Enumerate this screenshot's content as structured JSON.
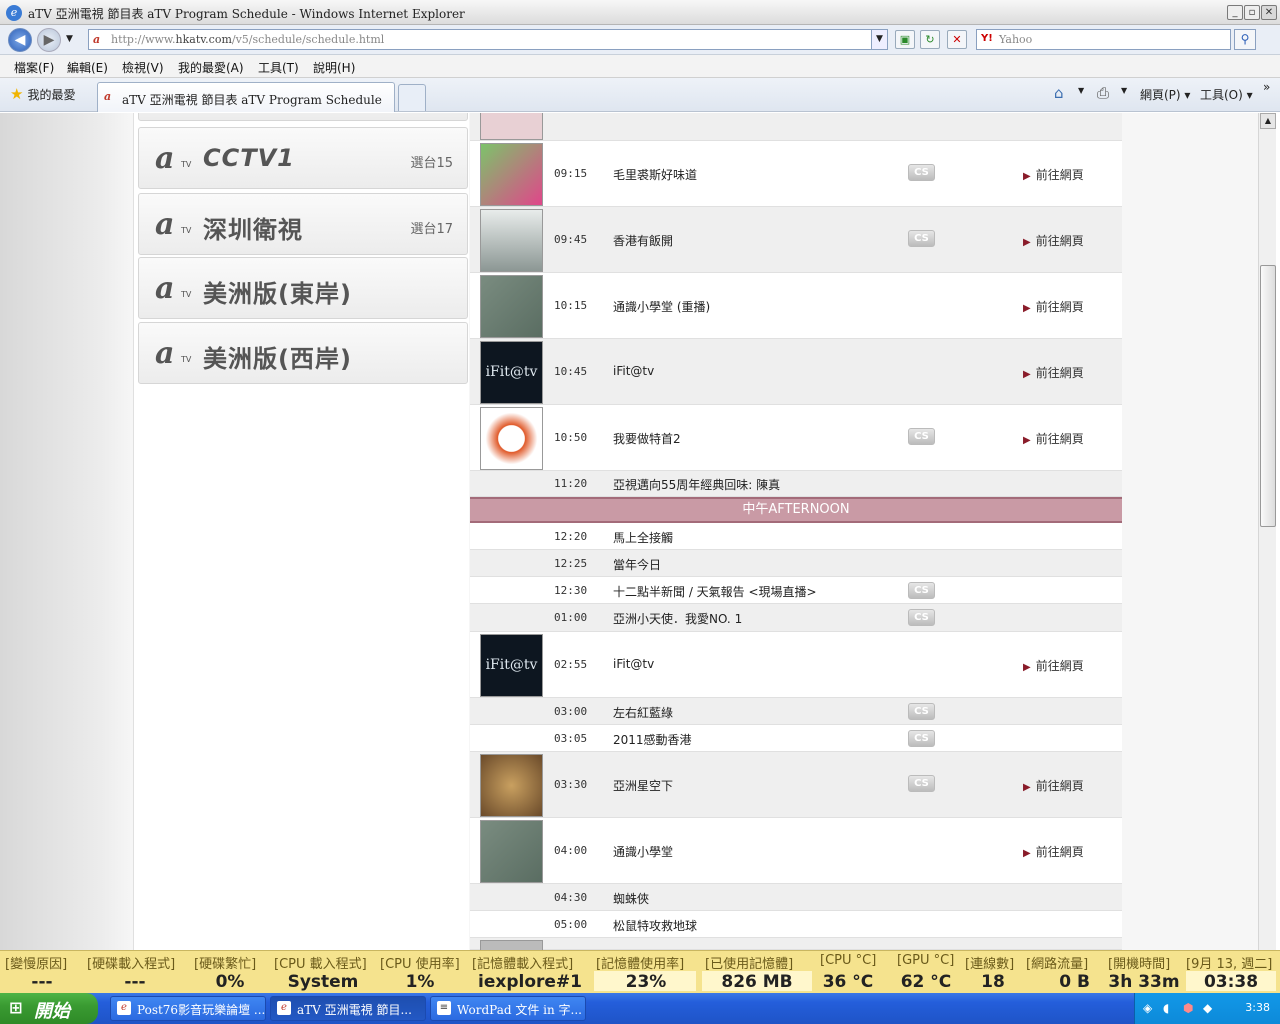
{
  "window": {
    "title": "aTV 亞洲電視 節目表 aTV Program Schedule - Windows Internet Explorer"
  },
  "address": {
    "url_prefix": "http://www.",
    "url_domain": "hkatv.com",
    "url_path": "/v5/schedule/schedule.html",
    "search_placeholder": "Yahoo"
  },
  "menu": [
    "檔案(F)",
    "編輯(E)",
    "檢視(V)",
    "我的最愛(A)",
    "工具(T)",
    "說明(H)"
  ],
  "tabs": {
    "favorites": "我的最愛",
    "active_tab": "aTV 亞洲電視 節目表 aTV Program Schedule",
    "page_menu": "網頁(P)",
    "tools_menu": "工具(O)"
  },
  "channels": [
    {
      "name": "CCTV1",
      "number": "選台15"
    },
    {
      "name": "深圳衛視",
      "number": "選台17"
    },
    {
      "name": "美洲版(東岸)",
      "number": ""
    },
    {
      "name": "美洲版(西岸)",
      "number": ""
    }
  ],
  "schedule_link_label": "前往網頁",
  "cs_label": "CS",
  "section_afternoon": "中午AFTERNOON",
  "schedule": [
    {
      "time": "09:15",
      "title": "毛里裘斯好味道",
      "cs": true,
      "link": true,
      "thumb_color": "#6aa84f"
    },
    {
      "time": "09:45",
      "title": "香港有飯開",
      "cs": true,
      "link": true,
      "thumb_color": "#9aa3a0"
    },
    {
      "time": "10:15",
      "title": "通識小學堂 (重播)",
      "cs": false,
      "link": true,
      "thumb_color": "#6f8a78"
    },
    {
      "time": "10:45",
      "title": "iFit@tv",
      "cs": false,
      "link": true,
      "thumb_color": "#1a2a3a"
    },
    {
      "time": "10:50",
      "title": "我要做特首2",
      "cs": true,
      "link": true,
      "thumb_color": "#e05a2a"
    },
    {
      "time": "11:20",
      "title": "亞視邁向55周年經典回味: 陳真",
      "cs": false,
      "link": false
    },
    {
      "time": "12:20",
      "title": "馬上全接觸",
      "cs": false,
      "link": false
    },
    {
      "time": "12:25",
      "title": "當年今日",
      "cs": false,
      "link": false
    },
    {
      "time": "12:30",
      "title": "十二點半新聞 / 天氣報告 <現場直播>",
      "cs": true,
      "link": false
    },
    {
      "time": "01:00",
      "title": "亞洲小天使．我愛NO. 1",
      "cs": true,
      "link": false
    },
    {
      "time": "02:55",
      "title": "iFit@tv",
      "cs": false,
      "link": true,
      "thumb_color": "#1a2a3a"
    },
    {
      "time": "03:00",
      "title": "左右紅藍綠",
      "cs": true,
      "link": false
    },
    {
      "time": "03:05",
      "title": "2011感動香港",
      "cs": true,
      "link": false
    },
    {
      "time": "03:30",
      "title": "亞洲星空下",
      "cs": true,
      "link": true,
      "thumb_color": "#8a6a3a"
    },
    {
      "time": "04:00",
      "title": "通識小學堂",
      "cs": false,
      "link": true,
      "thumb_color": "#6f8a78"
    },
    {
      "time": "04:30",
      "title": "蜘蛛俠",
      "cs": false,
      "link": false
    },
    {
      "time": "05:00",
      "title": "松鼠特攻救地球",
      "cs": false,
      "link": false
    }
  ],
  "monitor": {
    "labels": [
      "[變慢原因]",
      "[硬碟載入程式]",
      "[硬碟繁忙]",
      "[CPU 載入程式]",
      "[CPU 使用率]",
      "[記憶體載入程式]",
      "[記憶體使用率]",
      "[已使用記憶體]",
      "[CPU °C]",
      "[GPU °C]",
      "[連線數]",
      "[網路流量]",
      "[開機時間]",
      "[9月 13, 週二]"
    ],
    "values": [
      "---",
      "---",
      "0%",
      "System",
      "1%",
      "iexplore#1",
      "23%",
      "826 MB",
      "36 °C",
      "62 °C",
      "18",
      "0 B",
      "3h 33m",
      "03:38"
    ]
  },
  "taskbar": {
    "start": "開始",
    "tasks": [
      "Post76影音玩樂論壇 ...",
      "aTV 亞洲電視 節目...",
      "WordPad 文件 in 字..."
    ],
    "clock": "3:38"
  }
}
